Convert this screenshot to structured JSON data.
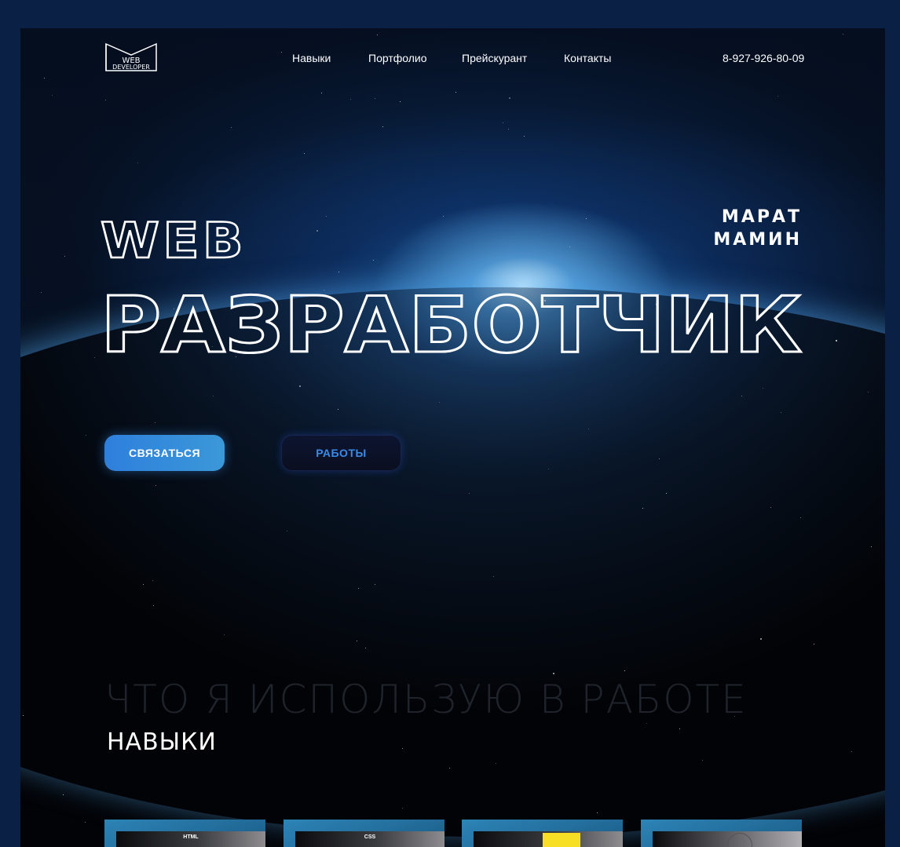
{
  "header": {
    "logo_text_1": "WEB",
    "logo_text_2": "DEVELOPER",
    "nav": [
      "Навыки",
      "Портфолио",
      "Прейскурант",
      "Контакты"
    ],
    "phone": "8-927-926-80-09"
  },
  "hero": {
    "title_line1": "WEB",
    "title_line2": "РАЗРАБОТЧИК",
    "name_line1": "МАРАТ",
    "name_line2": "МАМИН",
    "contact_button": "СВЯЗАТЬСЯ",
    "works_button": "РАБОТЫ"
  },
  "skills": {
    "background_heading": "ЧТО Я ИСПОЛЬЗУЮ В РАБОТЕ",
    "title": "НАВЫКИ",
    "cards": [
      {
        "label": "HTML"
      },
      {
        "label": "CSS"
      },
      {
        "label": ""
      },
      {
        "label": ""
      }
    ]
  },
  "colors": {
    "page_bg": "#0b2045",
    "accent_blue": "#2e7fdc",
    "works_text": "#3b8be8"
  }
}
